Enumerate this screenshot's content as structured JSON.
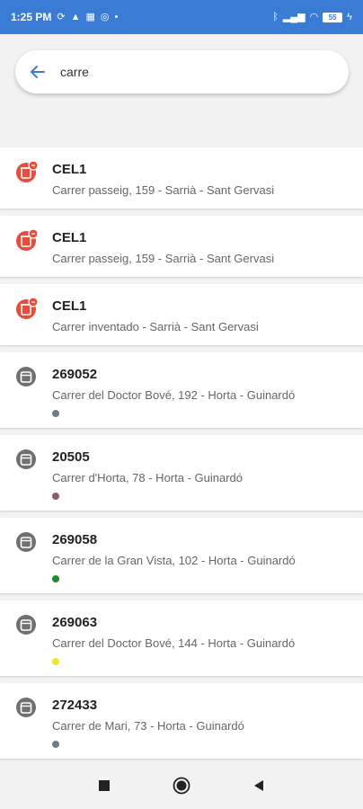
{
  "status_bar": {
    "time": "1:25 PM",
    "left_icons": [
      "sync-icon",
      "warning-icon",
      "app-icon",
      "circle-icon",
      "dot-icon"
    ],
    "right_icons": [
      "bluetooth-icon",
      "signal-icon",
      "wifi-icon",
      "battery-icon",
      "charging-icon"
    ],
    "battery_level": "55"
  },
  "search": {
    "value": "carre",
    "back_icon": "arrow-left-icon"
  },
  "colors": {
    "status_bar_bg": "#3a7bd5",
    "accent_red": "#e84c3d",
    "grey_icon": "#707070"
  },
  "results": [
    {
      "title": "CEL1",
      "subtitle": "Carrer passeig, 159 - Sarrià - Sant Gervasi",
      "icon": "red-bin-icon",
      "dot_color": null
    },
    {
      "title": "CEL1",
      "subtitle": "Carrer passeig, 159 - Sarrià - Sant Gervasi",
      "icon": "red-bin-icon",
      "dot_color": null
    },
    {
      "title": "CEL1",
      "subtitle": "Carrer inventado - Sarrià - Sant Gervasi",
      "icon": "red-bin-icon",
      "dot_color": null
    },
    {
      "title": "269052",
      "subtitle": "Carrer del Doctor Bové, 192 - Horta - Guinardó",
      "icon": "grey-container-icon",
      "dot_color": "#6b7f8f"
    },
    {
      "title": "20505",
      "subtitle": "Carrer d'Horta, 78 - Horta - Guinardó",
      "icon": "grey-container-icon",
      "dot_color": "#8a5a6a"
    },
    {
      "title": "269058",
      "subtitle": "Carrer de la Gran Vista, 102 - Horta - Guinardó",
      "icon": "grey-container-icon",
      "dot_color": "#1a8c2a"
    },
    {
      "title": "269063",
      "subtitle": "Carrer del Doctor Bové, 144 - Horta - Guinardó",
      "icon": "grey-container-icon",
      "dot_color": "#f2e52a"
    },
    {
      "title": "272433",
      "subtitle": "Carrer de Mari, 73 - Horta - Guinardó",
      "icon": "grey-container-icon",
      "dot_color": "#6b7f8f"
    }
  ],
  "nav": {
    "buttons": [
      "recents-square-icon",
      "home-circle-icon",
      "back-triangle-icon"
    ]
  }
}
